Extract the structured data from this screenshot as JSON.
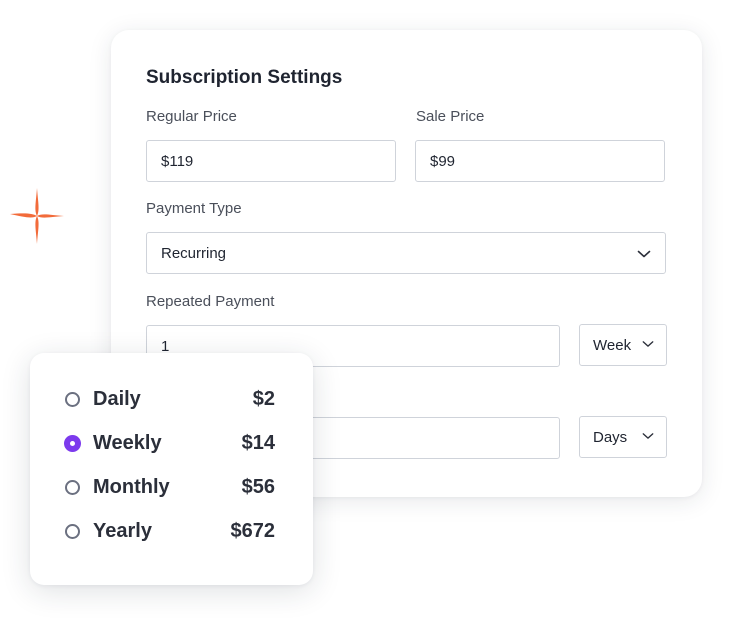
{
  "colors": {
    "accent": "#7c3aed",
    "sparkle": "#f26b3a",
    "text": "#1f2430"
  },
  "settings": {
    "title": "Subscription Settings",
    "regular_price": {
      "label": "Regular Price",
      "value": "$119"
    },
    "sale_price": {
      "label": "Sale Price",
      "value": "$99"
    },
    "payment_type": {
      "label": "Payment Type",
      "value": "Recurring",
      "icon": "chevron-down-icon"
    },
    "repeated_payment": {
      "label": "Repeated Payment",
      "value": "1",
      "unit": "Week"
    },
    "second_row": {
      "value": "",
      "unit": "Days"
    }
  },
  "billing_options": [
    {
      "name": "Daily",
      "price": "$2",
      "selected": false
    },
    {
      "name": "Weekly",
      "price": "$14",
      "selected": true
    },
    {
      "name": "Monthly",
      "price": "$56",
      "selected": false
    },
    {
      "name": "Yearly",
      "price": "$672",
      "selected": false
    }
  ]
}
